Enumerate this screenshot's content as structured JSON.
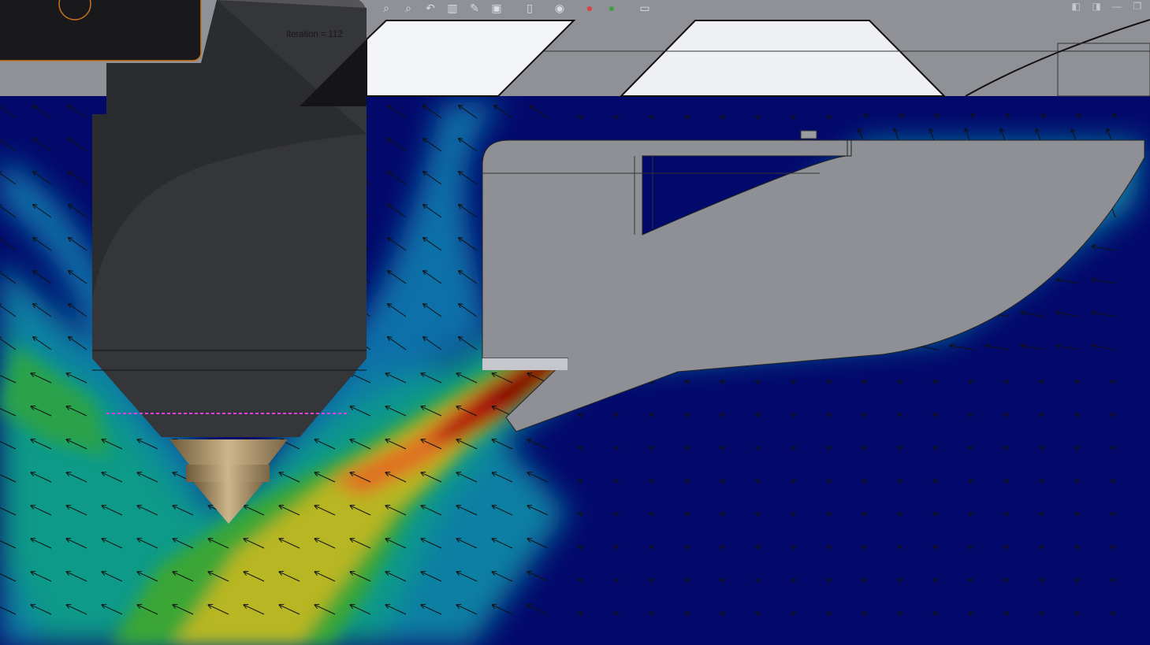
{
  "viewport": {
    "iteration_label": "Iteration = 112",
    "colors": {
      "background_fluid": "#02096b",
      "cad_grey": "#8f9197",
      "head_dark": "#2a2b2e",
      "nozzle_brass": "#a88d62",
      "probe_line": "#e040e0"
    }
  },
  "toolbar": {
    "icons": [
      "zoom-to-fit-icon",
      "zoom-area-icon",
      "previous-view-icon",
      "section-view-icon",
      "view-settings-icon",
      "display-style-icon",
      "view-orientation-icon",
      "hide-show-icon",
      "edit-appearance-icon",
      "scene-icon",
      "monitor-icon"
    ]
  },
  "window_controls": {
    "icons": [
      "tile-left-icon",
      "tile-right-icon",
      "minimize-icon",
      "restore-icon"
    ]
  }
}
